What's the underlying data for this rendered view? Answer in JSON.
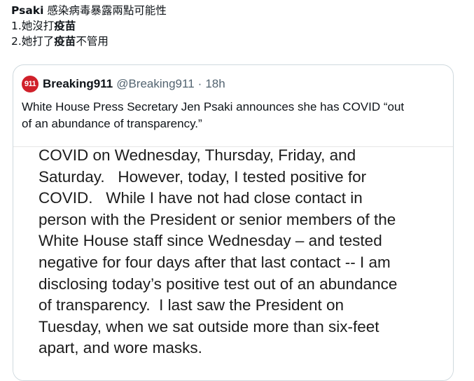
{
  "tweet": {
    "title_bold": "Psaki",
    "title_rest": " 感染病毒暴露兩點可能性",
    "line2_pre": "1.她沒打",
    "line2_bold": "疫苗",
    "line3_pre": "2.她打了",
    "line3_bold": "疫苗",
    "line3_post": "不管用"
  },
  "quote": {
    "avatar_text": "911",
    "name": "Breaking911",
    "handle": "@Breaking911",
    "separator": "·",
    "time": "18h",
    "text_lines": [
      "White House Press Secretary Jen Psaki announces she has COVID “out",
      "of an abundance of transparency.”"
    ],
    "brand_color": "#d0202a"
  },
  "media": {
    "lines": [
      "COVID on Wednesday, Thursday, Friday, and",
      "Saturday.   However, today, I tested positive for",
      "COVID.   While I have not had close contact in",
      "person with the President or senior members of the",
      "White House staff since Wednesday – and tested",
      "negative for four days after that last contact -- I am",
      "disclosing today’s positive test out of an abundance",
      "of transparency.  I last saw the President on",
      "Tuesday, when we sat outside more than six-feet",
      "apart, and wore masks."
    ]
  }
}
